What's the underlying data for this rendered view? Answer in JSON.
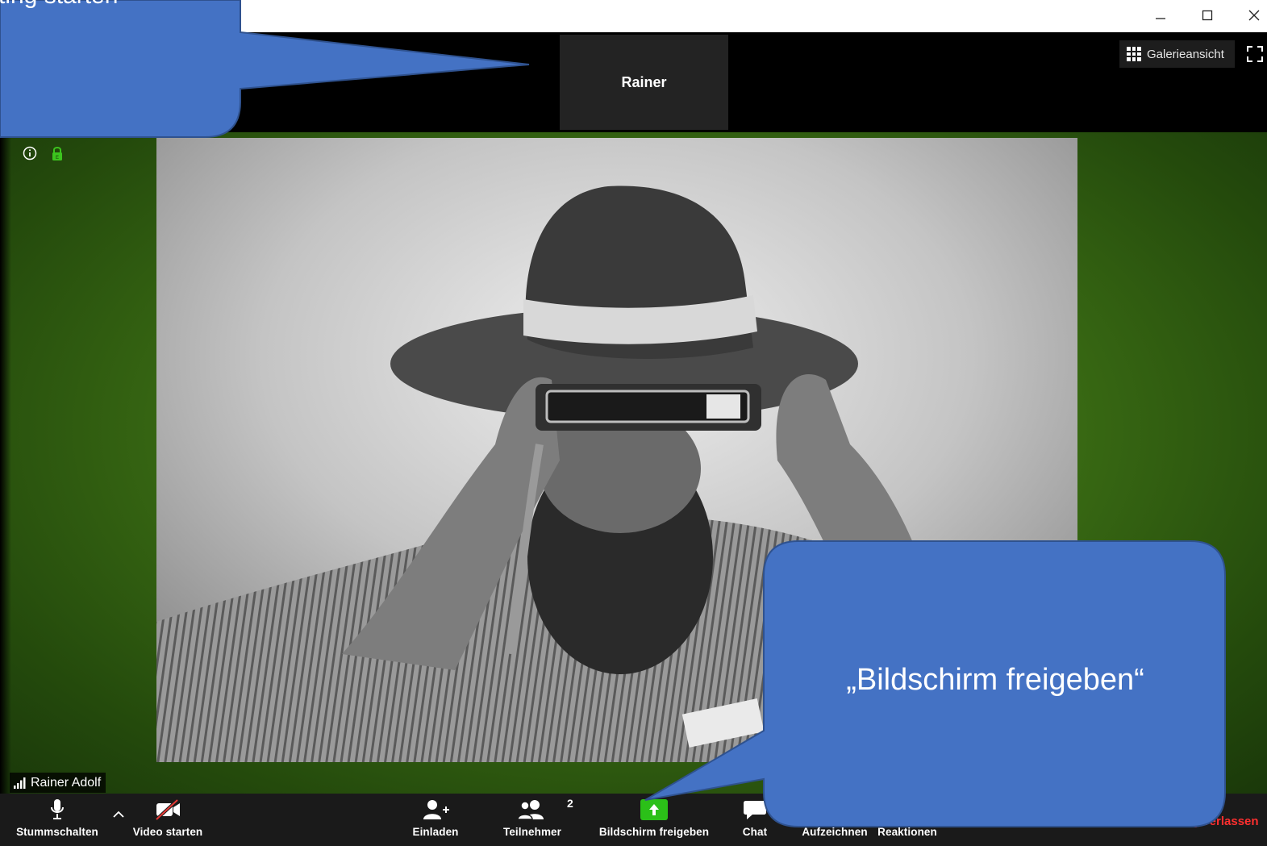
{
  "window": {
    "minimize_icon": "minimize-icon",
    "maximize_icon": "maximize-icon",
    "close_icon": "close-icon"
  },
  "thumbnail": {
    "participant_name": "Rainer"
  },
  "view_controls": {
    "gallery_label": "Galerieansicht",
    "gallery_icon": "grid-icon",
    "fullscreen_icon": "fullscreen-icon"
  },
  "meeting_info": {
    "info_icon": "info-icon",
    "lock_icon": "lock-icon",
    "lock_color": "#3cc41e"
  },
  "video": {
    "participant_name": "Rainer Adolf"
  },
  "toolbar": {
    "mute_label": "Stummschalten",
    "video_label": "Video starten",
    "invite_label": "Einladen",
    "participants_label": "Teilnehmer",
    "participants_count": "2",
    "share_label": "Bildschirm freigeben",
    "chat_label": "Chat",
    "record_label": "Aufzeichnen",
    "reactions_label": "Reaktionen",
    "leave_label": "g verlassen",
    "share_color": "#2bc018",
    "leave_color": "#ff2f2f"
  },
  "callouts": {
    "top_left_text": "ting starten",
    "bottom_right_text": "„Bildschirm freigeben“",
    "fill_color": "#4472c4"
  }
}
